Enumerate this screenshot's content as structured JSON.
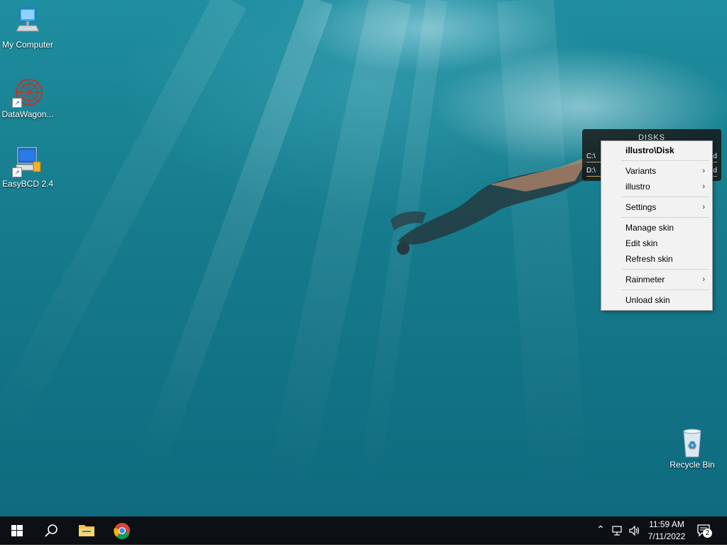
{
  "desktop": {
    "icons": [
      {
        "label": "My Computer",
        "icon": "computer-icon"
      },
      {
        "label": "DataWagon...",
        "icon": "datawagon-icon"
      },
      {
        "label": "EasyBCD 2.4",
        "icon": "easybcd-icon"
      },
      {
        "label": "Recycle Bin",
        "icon": "recycle-bin-icon"
      }
    ]
  },
  "widget": {
    "title": "DISKS",
    "drives": [
      {
        "label": "C:\\",
        "status": "ed"
      },
      {
        "label": "D:\\",
        "status": "ed"
      }
    ]
  },
  "context_menu": {
    "header": "illustro\\Disk",
    "items": [
      {
        "label": "Variants",
        "submenu": true
      },
      {
        "label": "illustro",
        "submenu": true
      },
      {
        "label": "Settings",
        "submenu": true
      },
      {
        "label": "Manage skin",
        "submenu": false
      },
      {
        "label": "Edit skin",
        "submenu": false
      },
      {
        "label": "Refresh skin",
        "submenu": false
      },
      {
        "label": "Rainmeter",
        "submenu": true
      },
      {
        "label": "Unload skin",
        "submenu": false
      }
    ],
    "submenu_arrow": "›"
  },
  "taskbar": {
    "time": "11:59 AM",
    "date": "7/11/2022",
    "notification_count": "2",
    "apps": [
      "start-icon",
      "search-icon",
      "file-explorer-icon",
      "chrome-icon"
    ]
  }
}
